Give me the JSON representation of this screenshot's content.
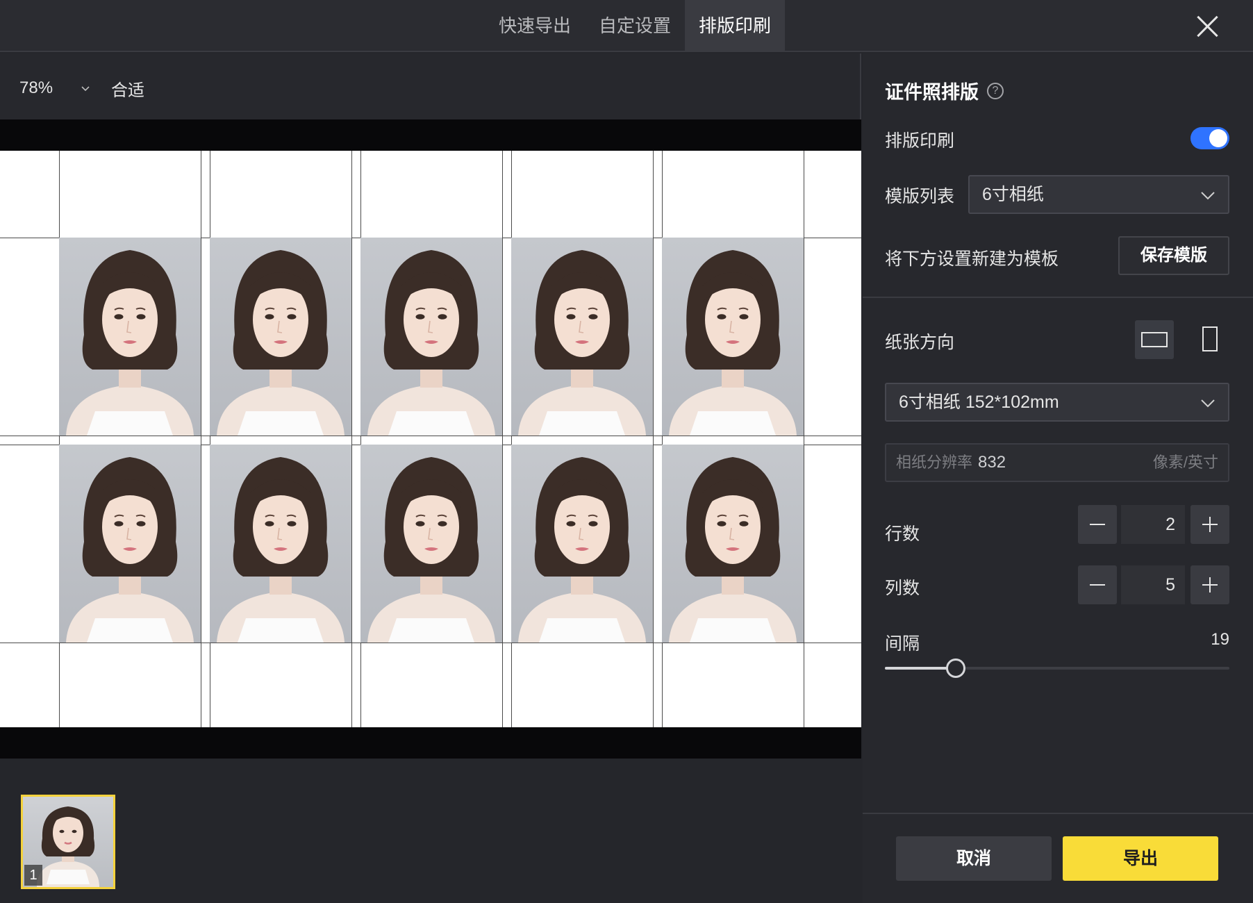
{
  "tabs": [
    {
      "label": "快速导出"
    },
    {
      "label": "自定设置"
    },
    {
      "label": "排版印刷"
    }
  ],
  "active_tab": "排版印刷",
  "zoom": {
    "value": "78%",
    "fit_label": "合适"
  },
  "layout": {
    "rows": 2,
    "columns": 5,
    "gap": 19
  },
  "thumbnails": [
    {
      "index": "1"
    }
  ],
  "panel": {
    "title": "证件照排版",
    "print_layout_label": "排版印刷",
    "print_layout_enabled": true,
    "template_list_label": "模版列表",
    "template_list_value": "6寸相纸",
    "new_template_label": "将下方设置新建为模板",
    "save_template_button": "保存模版",
    "orientation_label": "纸张方向",
    "orientation_selected": "landscape",
    "paper_size_value": "6寸相纸 152*102mm",
    "resolution_label": "相纸分辨率",
    "resolution_value": "832",
    "resolution_unit": "像素/英寸",
    "rows_label": "行数",
    "rows_value": "2",
    "columns_label": "列数",
    "columns_value": "5",
    "gap_label": "间隔",
    "gap_value": "19",
    "cancel_button": "取消",
    "export_button": "导出"
  },
  "colors": {
    "accent": "#2f73ff",
    "export": "#f9dc38",
    "thumb_border": "#f4d23c"
  }
}
